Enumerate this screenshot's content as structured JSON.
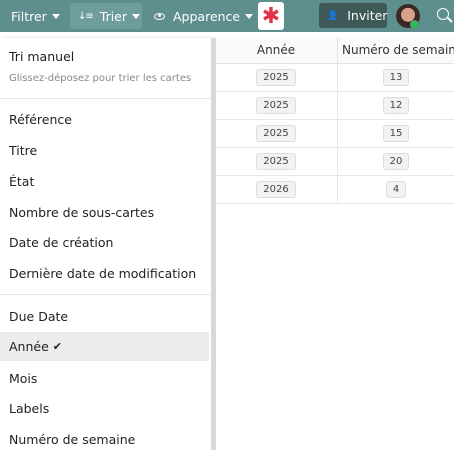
{
  "toolbar": {
    "filter_label": "Filtrer",
    "sort_label": "Trier",
    "appearance_label": "Apparence",
    "app_icon_glyph": "✱",
    "invite_label": "Inviter",
    "colors": {
      "toolbar_bg": "#5f8e8e",
      "active_button": "#6f9d9d",
      "invite_button": "#3f5959",
      "app_icon": "#e03348",
      "presence": "#29c04f"
    }
  },
  "table": {
    "columns": [
      "Année",
      "Numéro de semaine"
    ],
    "rows": [
      {
        "year": "2025",
        "week": "13"
      },
      {
        "year": "2025",
        "week": "12"
      },
      {
        "year": "2025",
        "week": "15"
      },
      {
        "year": "2025",
        "week": "20"
      },
      {
        "year": "2026",
        "week": "4"
      }
    ]
  },
  "sort_menu": {
    "manual_label": "Tri manuel",
    "manual_hint": "Glissez-déposez pour trier les cartes",
    "items": [
      "Référence",
      "Titre",
      "État",
      "Nombre de sous-cartes",
      "Date de création",
      "Dernière date de modification",
      "Due Date",
      "Année",
      "Mois",
      "Labels",
      "Numéro de semaine"
    ],
    "selected_item": "Année",
    "check_glyph": "✔"
  }
}
